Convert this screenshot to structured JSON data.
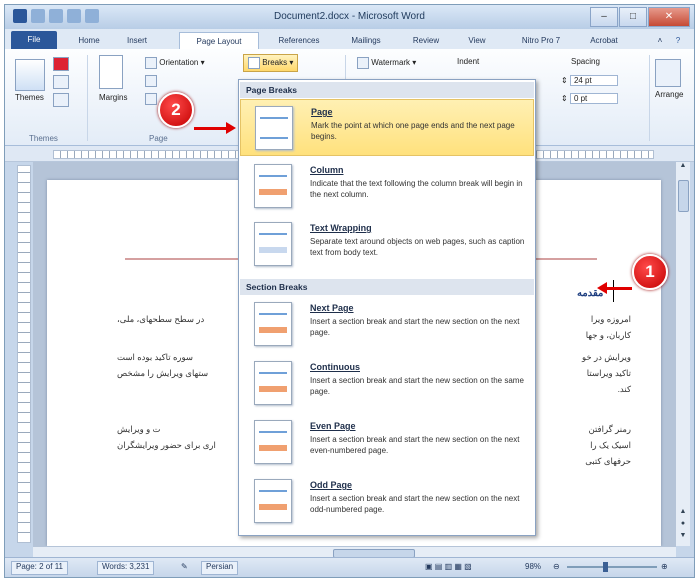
{
  "window": {
    "title": "Document2.docx - Microsoft Word",
    "controls": [
      "–",
      "□",
      "✕"
    ]
  },
  "tabs": [
    "File",
    "Home",
    "Insert",
    "Page Layout",
    "References",
    "Mailings",
    "Review",
    "View",
    "Nitro Pro 7",
    "Acrobat"
  ],
  "active_tab": "Page Layout",
  "ribbon": {
    "themes_label": "Themes",
    "themes_group": "Themes",
    "margins_label": "Margins",
    "page_setup_group": "Page",
    "orientation_label": "Orientation",
    "breaks_label": "Breaks",
    "watermark_label": "Watermark",
    "indent_label": "Indent",
    "spacing_label": "Spacing",
    "spacing_before": "24 pt",
    "spacing_after": "0 pt",
    "arrange_label": "Arrange"
  },
  "breaks_menu": {
    "page_breaks_header": "Page Breaks",
    "section_breaks_header": "Section Breaks",
    "items": [
      {
        "title": "Page",
        "desc": "Mark the point at which one page ends and the next page begins."
      },
      {
        "title": "Column",
        "desc": "Indicate that the text following the column break will begin in the next column."
      },
      {
        "title": "Text Wrapping",
        "desc": "Separate text around objects on web pages, such as caption text from body text."
      },
      {
        "title": "Next Page",
        "desc": "Insert a section break and start the new section on the next page."
      },
      {
        "title": "Continuous",
        "desc": "Insert a section break and start the new section on the same page."
      },
      {
        "title": "Even Page",
        "desc": "Insert a section break and start the new section on the next even-numbered page."
      },
      {
        "title": "Odd Page",
        "desc": "Insert a section break and start the new section on the next odd-numbered page."
      }
    ]
  },
  "document": {
    "heading": "مقدمه",
    "lines_right": [
      "امروزه ویرا",
      "کاربان، و جها",
      "ویرایش در خو",
      "تاکید ویراستا",
      "کند.",
      "رمنر گرافتن",
      "اسیک یک را",
      "حرفهای کتبی"
    ],
    "lines_left": [
      "در سطح سطحهای، ملی،",
      "سوره تاکید بوده است",
      "ستهای ویرایش را مشخص",
      "ت و ویرایش",
      "اری برای حضور ویرایشگران"
    ]
  },
  "callouts": {
    "one": "1",
    "two": "2"
  },
  "statusbar": {
    "page": "Page: 2 of 11",
    "words": "Words: 3,231",
    "language": "Persian",
    "zoom": "98%"
  }
}
